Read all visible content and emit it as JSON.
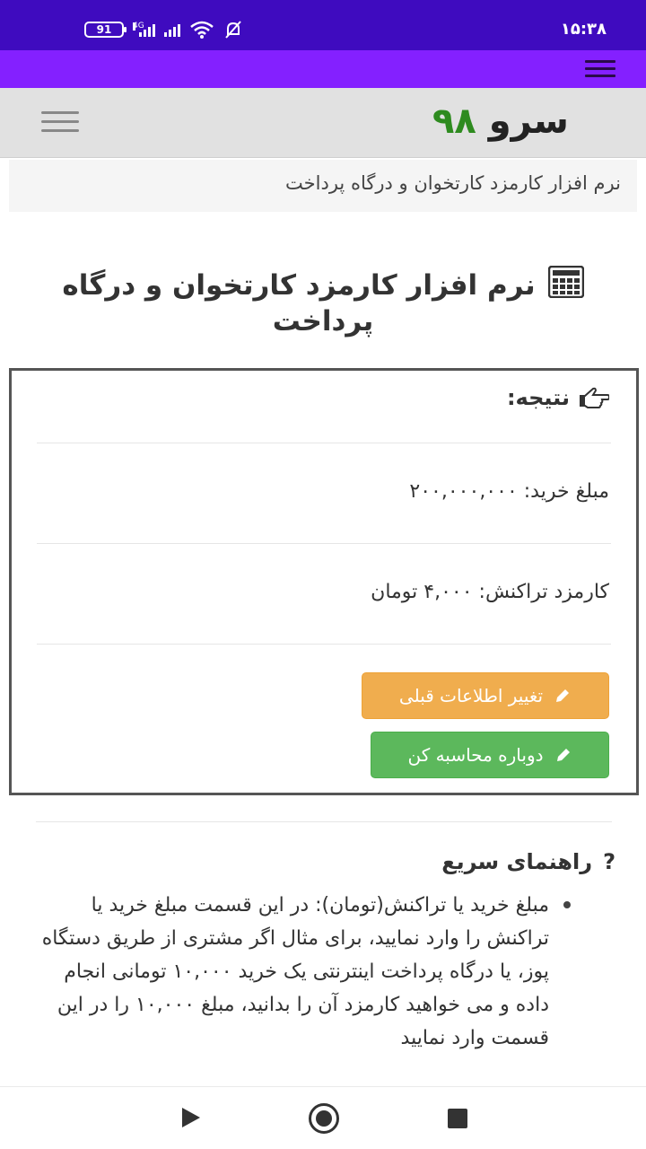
{
  "status_bar": {
    "time": "۱۵:۳۸",
    "battery": "91",
    "signal_label": "4G"
  },
  "header": {
    "logo_text": "سرو",
    "logo_number": "۹۸"
  },
  "breadcrumb": "نرم افزار کارمزد کارتخوان و درگاه پرداخت",
  "page_title": "نرم افزار کارمزد کارتخوان و درگاه پرداخت",
  "result": {
    "heading": "نتیجه:",
    "purchase_line": "مبلغ خرید: ۲۰۰,۰۰۰,۰۰۰",
    "fee_line": "کارمزد تراکنش: ۴,۰۰۰ تومان",
    "change_button": "تغییر اطلاعات قبلی",
    "recalc_button": "دوباره محاسبه کن"
  },
  "guide": {
    "heading": "راهنمای سریع",
    "items": [
      "مبلغ خرید یا تراکنش(تومان): در این قسمت مبلغ خرید یا تراکنش را وارد نمایید، برای مثال اگر مشتری از طریق دستگاه پوز، یا درگاه پرداخت اینترنتی یک خرید ۱۰,۰۰۰ تومانی انجام داده و می خواهید کارمزد آن را بدانید، مبلغ ۱۰,۰۰۰ را در این قسمت وارد نمایید"
    ]
  },
  "colors": {
    "status_bar": "#3f0bbf",
    "app_bar": "#8420ff",
    "logo_accent": "#2e8b1f",
    "warning_button": "#f0ad4e",
    "success_button": "#5cb85c"
  }
}
